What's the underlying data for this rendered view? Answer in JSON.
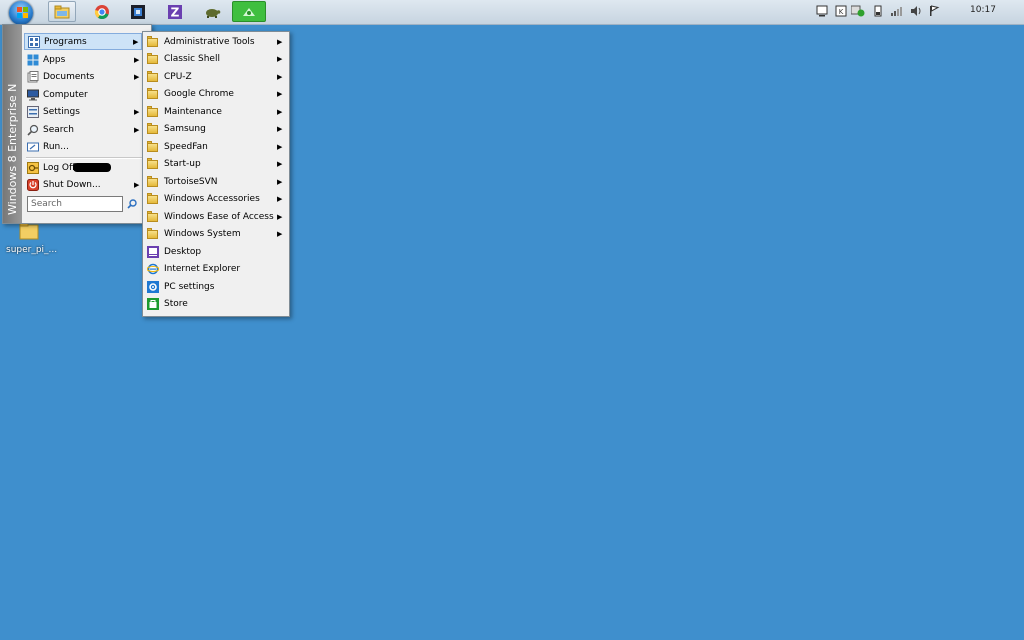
{
  "taskbar": {
    "clock": "10:17",
    "buttons": [
      {
        "name": "file-explorer-icon",
        "active": true
      },
      {
        "name": "chrome-icon",
        "active": false
      },
      {
        "name": "cpu-z-icon",
        "active": false
      },
      {
        "name": "z-app-icon",
        "active": false
      },
      {
        "name": "turtle-app-icon",
        "active": false
      },
      {
        "name": "green-app-icon",
        "active": false
      }
    ]
  },
  "desktop": {
    "icon_label": "super_pi_..."
  },
  "start_menu": {
    "banner": "Windows 8 Enterprise N",
    "items": [
      {
        "label": "Programs",
        "arrow": "▶",
        "icon": "programs-icon"
      },
      {
        "label": "Apps",
        "arrow": "▶",
        "icon": "apps-icon"
      },
      {
        "label": "Documents",
        "arrow": "▶",
        "icon": "documents-icon"
      },
      {
        "label": "Computer",
        "arrow": "",
        "icon": "computer-icon"
      },
      {
        "label": "Settings",
        "arrow": "▶",
        "icon": "settings-icon"
      },
      {
        "label": "Search",
        "arrow": "▶",
        "icon": "search-icon"
      },
      {
        "label": "Run...",
        "arrow": "",
        "icon": "run-icon"
      },
      {
        "label": "Log Off",
        "arrow": "",
        "icon": "log-off-icon"
      },
      {
        "label": "Shut Down...",
        "arrow": "▶",
        "icon": "shut-down-icon"
      }
    ],
    "search_placeholder": "Search"
  },
  "programs_submenu": {
    "items": [
      {
        "label": "Administrative Tools",
        "arrow": "▶"
      },
      {
        "label": "Classic Shell",
        "arrow": "▶"
      },
      {
        "label": "CPU-Z",
        "arrow": "▶"
      },
      {
        "label": "Google Chrome",
        "arrow": "▶"
      },
      {
        "label": "Maintenance",
        "arrow": "▶"
      },
      {
        "label": "Samsung",
        "arrow": "▶"
      },
      {
        "label": "SpeedFan",
        "arrow": "▶"
      },
      {
        "label": "Start-up",
        "arrow": "▶"
      },
      {
        "label": "TortoiseSVN",
        "arrow": "▶"
      },
      {
        "label": "Windows Accessories",
        "arrow": "▶"
      },
      {
        "label": "Windows Ease of Access",
        "arrow": "▶"
      },
      {
        "label": "Windows System",
        "arrow": "▶"
      },
      {
        "label": "Desktop",
        "arrow": ""
      },
      {
        "label": "Internet Explorer",
        "arrow": ""
      },
      {
        "label": "PC settings",
        "arrow": ""
      },
      {
        "label": "Store",
        "arrow": ""
      }
    ]
  },
  "colors": {
    "desktop": "#3f8fcd",
    "menu_bg": "#f0f0f0",
    "selection": "#cde3f7"
  }
}
